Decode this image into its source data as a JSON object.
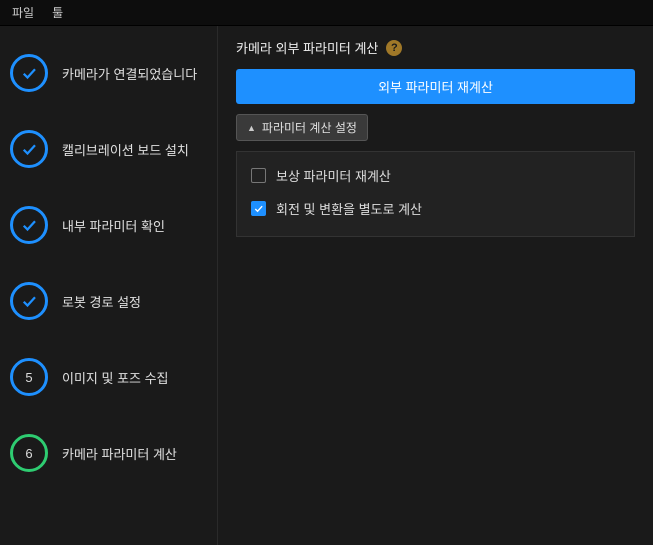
{
  "menubar": {
    "file": "파일",
    "tools": "툴"
  },
  "sidebar": {
    "steps": [
      {
        "label": "카메라가 연결되었습니다",
        "state": "done"
      },
      {
        "label": "캘리브레이션 보드 설치",
        "state": "done"
      },
      {
        "label": "내부 파라미터 확인",
        "state": "done"
      },
      {
        "label": "로봇 경로 설정",
        "state": "done"
      },
      {
        "label": "이미지 및 포즈 수집",
        "state": "num",
        "num": "5"
      },
      {
        "label": "카메라 파라미터 계산",
        "state": "current",
        "num": "6"
      }
    ]
  },
  "main": {
    "title": "카메라 외부 파라미터 계산",
    "help": "?",
    "primary_button": "외부 파라미터 재계산",
    "section_title": "파라미터 계산 설정",
    "options": [
      {
        "label": "보상 파라미터 재계산",
        "checked": false
      },
      {
        "label": "회전 및 변환을 별도로 계산",
        "checked": true
      }
    ]
  }
}
